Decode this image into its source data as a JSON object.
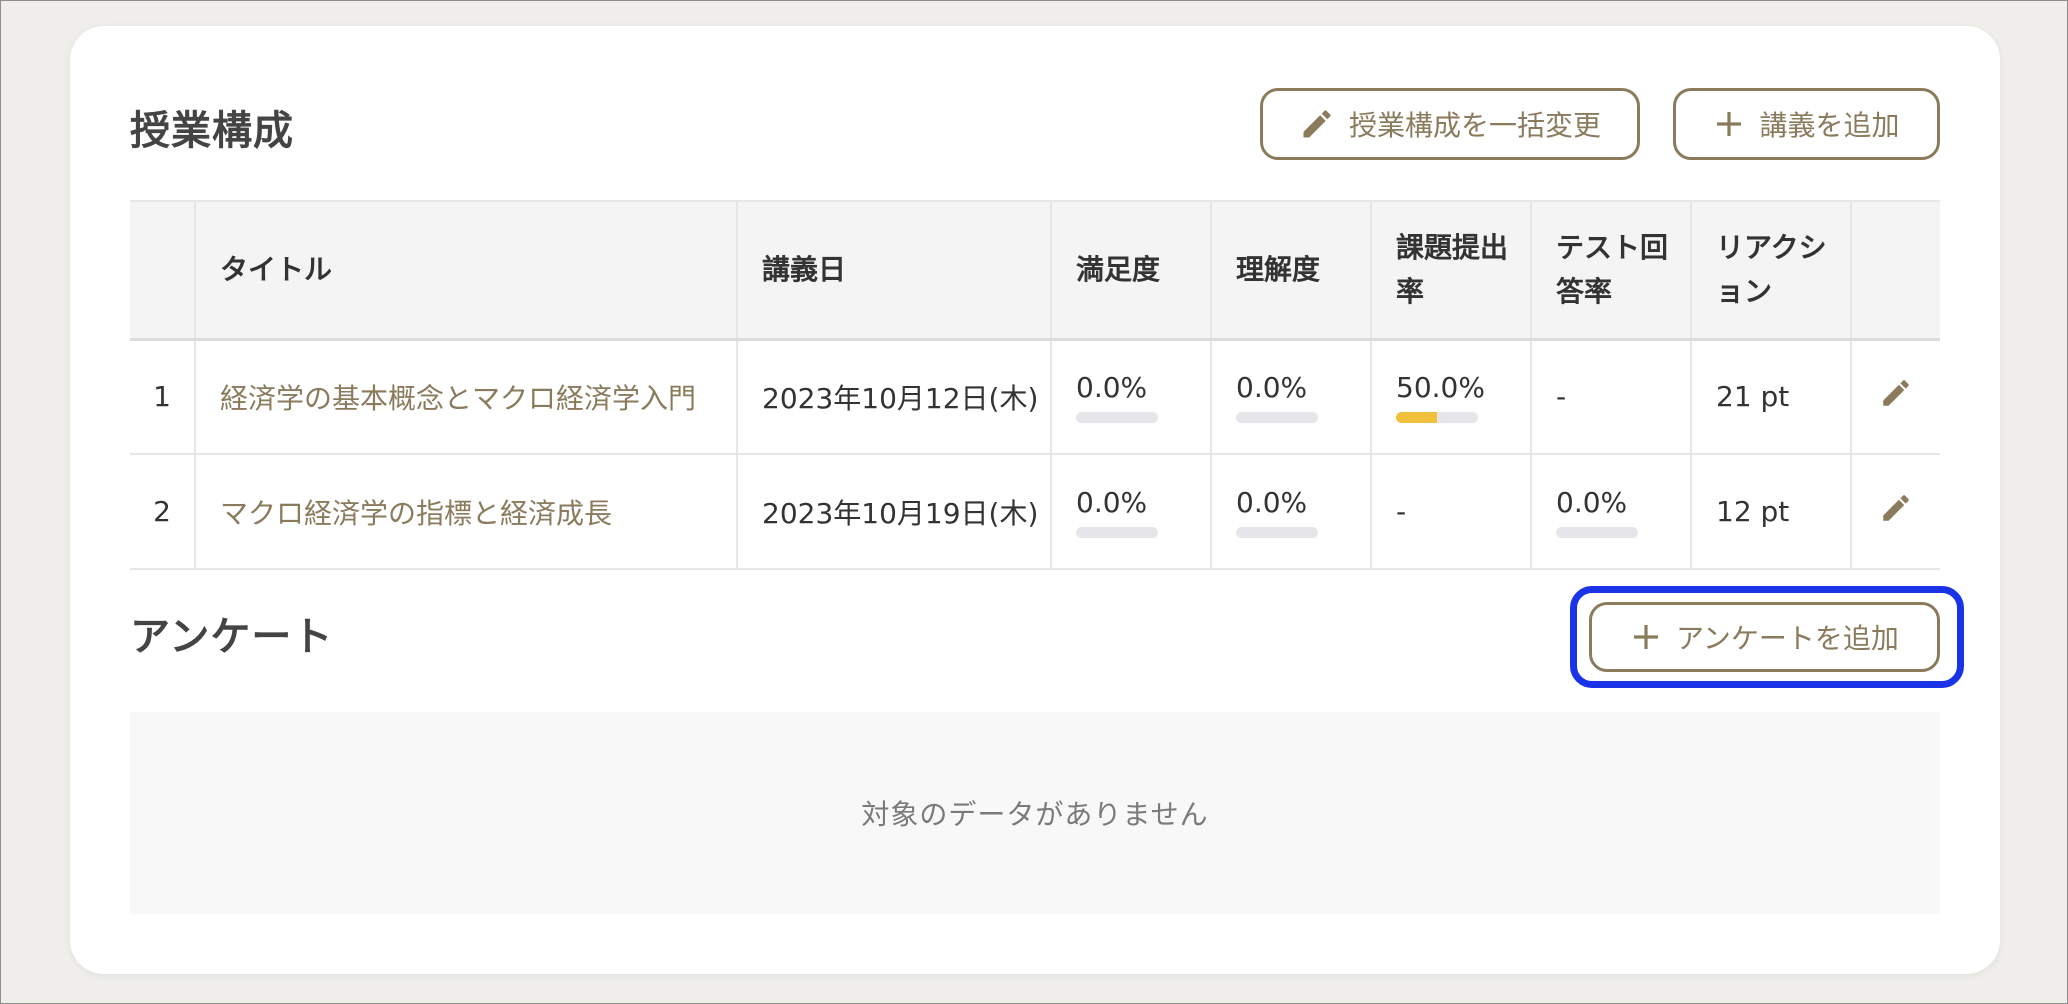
{
  "course_section": {
    "title": "授業構成",
    "bulk_edit_label": "授業構成を一括変更",
    "add_lecture_label": "講義を追加",
    "table": {
      "headers": {
        "number": "",
        "title": "タイトル",
        "date": "講義日",
        "satisfaction": "満足度",
        "understanding": "理解度",
        "assignment_rate": "課題提出率",
        "test_rate": "テスト回答率",
        "reaction": "リアクション"
      },
      "rows": [
        {
          "number": "1",
          "title": "経済学の基本概念とマクロ経済学入門",
          "date": "2023年10月12日(木)",
          "satisfaction": "0.0%",
          "understanding": "0.0%",
          "assignment_rate": "50.0%",
          "test_rate": "-",
          "reaction": "21 pt"
        },
        {
          "number": "2",
          "title": "マクロ経済学の指標と経済成長",
          "date": "2023年10月19日(木)",
          "satisfaction": "0.0%",
          "understanding": "0.0%",
          "assignment_rate": "-",
          "test_rate": "0.0%",
          "reaction": "12 pt"
        }
      ]
    }
  },
  "survey_section": {
    "title": "アンケート",
    "add_survey_label": "アンケートを追加",
    "empty_message": "対象のデータがありません"
  },
  "colors": {
    "accent": "#8a7b5d",
    "progress_fill": "#f0c03c",
    "progress_track": "#e6e6ea",
    "highlight": "#1a33e6"
  },
  "icons": [
    "pencil-icon",
    "plus-icon",
    "edit-icon"
  ]
}
